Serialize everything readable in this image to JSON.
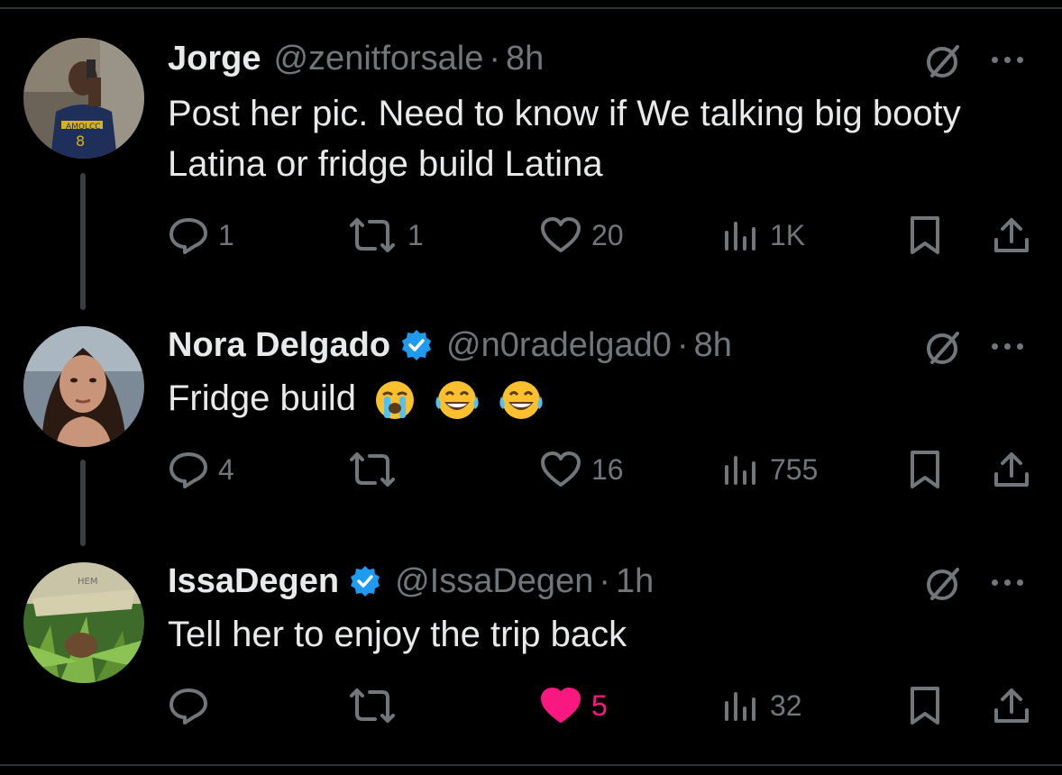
{
  "tweets": [
    {
      "name": "Jorge",
      "handle": "@zenitforsale",
      "separator": "·",
      "time": "8h",
      "verified": false,
      "text": "Post her pic. Need to know if We talking big booty Latina or fridge build Latina",
      "replies": "1",
      "reposts": "1",
      "likes": "20",
      "views": "1K",
      "liked": false
    },
    {
      "name": "Nora Delgado",
      "handle": "@n0radelgad0",
      "separator": "·",
      "time": "8h",
      "verified": true,
      "text": "Fridge build",
      "emojis": [
        "loudly-crying-face",
        "face-with-tears-of-joy",
        "face-with-tears-of-joy"
      ],
      "replies": "4",
      "reposts": "",
      "likes": "16",
      "views": "755",
      "liked": false
    },
    {
      "name": "IssaDegen",
      "handle": "@IssaDegen",
      "separator": "·",
      "time": "1h",
      "verified": true,
      "text": "Tell her to enjoy the trip back",
      "replies": "",
      "reposts": "",
      "likes": "5",
      "views": "32",
      "liked": true
    }
  ],
  "colors": {
    "background": "#000000",
    "text": "#e7e9ea",
    "muted": "#71767b",
    "verified": "#1d9bf0",
    "like_active": "#f91880"
  }
}
